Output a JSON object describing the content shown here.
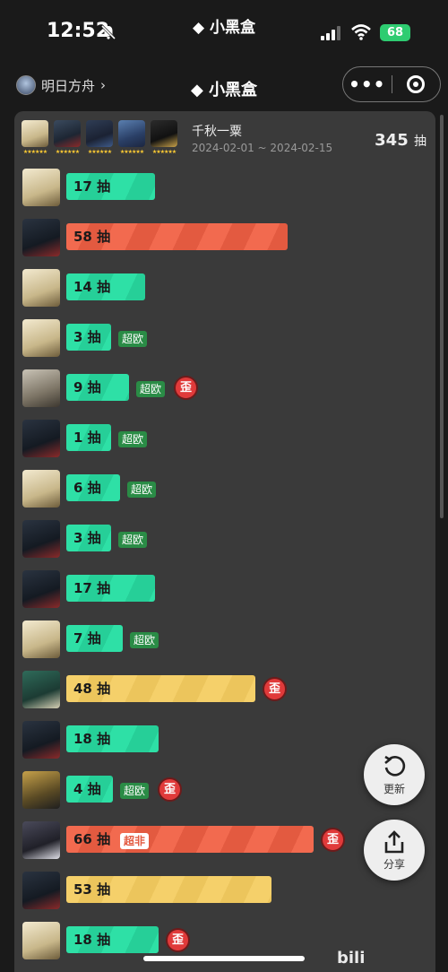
{
  "status": {
    "time": "12:52",
    "app_name": "小黑盒",
    "battery": "68"
  },
  "nav": {
    "game_name": "明日方舟",
    "title": "小黑盒",
    "more_label": "•••"
  },
  "banner": {
    "name": "千秋一粟",
    "date_range": "2024-02-01 ~ 2024-02-15",
    "total_count": "345",
    "total_unit": "抽",
    "star_text": "★★★★★★"
  },
  "colors": {
    "green": "#2ee0a6",
    "red": "#f26a4f",
    "yellow": "#f5d06a",
    "badge_green": "#2a8c46",
    "wai_red": "#e03a3a"
  },
  "rows": [
    {
      "label": "17 抽",
      "pulls": 17,
      "color": "green",
      "badge": "",
      "wai": ""
    },
    {
      "label": "58 抽",
      "pulls": 58,
      "color": "red",
      "badge": "",
      "wai": ""
    },
    {
      "label": "14 抽",
      "pulls": 14,
      "color": "green",
      "badge": "",
      "wai": ""
    },
    {
      "label": "3 抽",
      "pulls": 3,
      "color": "green",
      "badge": "超欧",
      "wai": ""
    },
    {
      "label": "9 抽",
      "pulls": 9,
      "color": "green",
      "badge": "超欧",
      "wai": "歪"
    },
    {
      "label": "1 抽",
      "pulls": 1,
      "color": "green",
      "badge": "超欧",
      "wai": ""
    },
    {
      "label": "6 抽",
      "pulls": 6,
      "color": "green",
      "badge": "超欧",
      "wai": ""
    },
    {
      "label": "3 抽",
      "pulls": 3,
      "color": "green",
      "badge": "超欧",
      "wai": ""
    },
    {
      "label": "17 抽",
      "pulls": 17,
      "color": "green",
      "badge": "",
      "wai": ""
    },
    {
      "label": "7 抽",
      "pulls": 7,
      "color": "green",
      "badge": "超欧",
      "wai": ""
    },
    {
      "label": "48 抽",
      "pulls": 48,
      "color": "yellow",
      "badge": "",
      "wai": "歪"
    },
    {
      "label": "18 抽",
      "pulls": 18,
      "color": "green",
      "badge": "",
      "wai": ""
    },
    {
      "label": "4 抽",
      "pulls": 4,
      "color": "green",
      "badge": "超欧",
      "wai": "歪"
    },
    {
      "label": "66 抽",
      "pulls": 66,
      "color": "red",
      "badge": "超非",
      "wai": "歪"
    },
    {
      "label": "53 抽",
      "pulls": 53,
      "color": "yellow",
      "badge": "",
      "wai": ""
    },
    {
      "label": "18 抽",
      "pulls": 18,
      "color": "green",
      "badge": "",
      "wai": "歪"
    }
  ],
  "buttons": {
    "refresh_label": "更新",
    "share_label": "分享"
  },
  "watermark": "bili"
}
